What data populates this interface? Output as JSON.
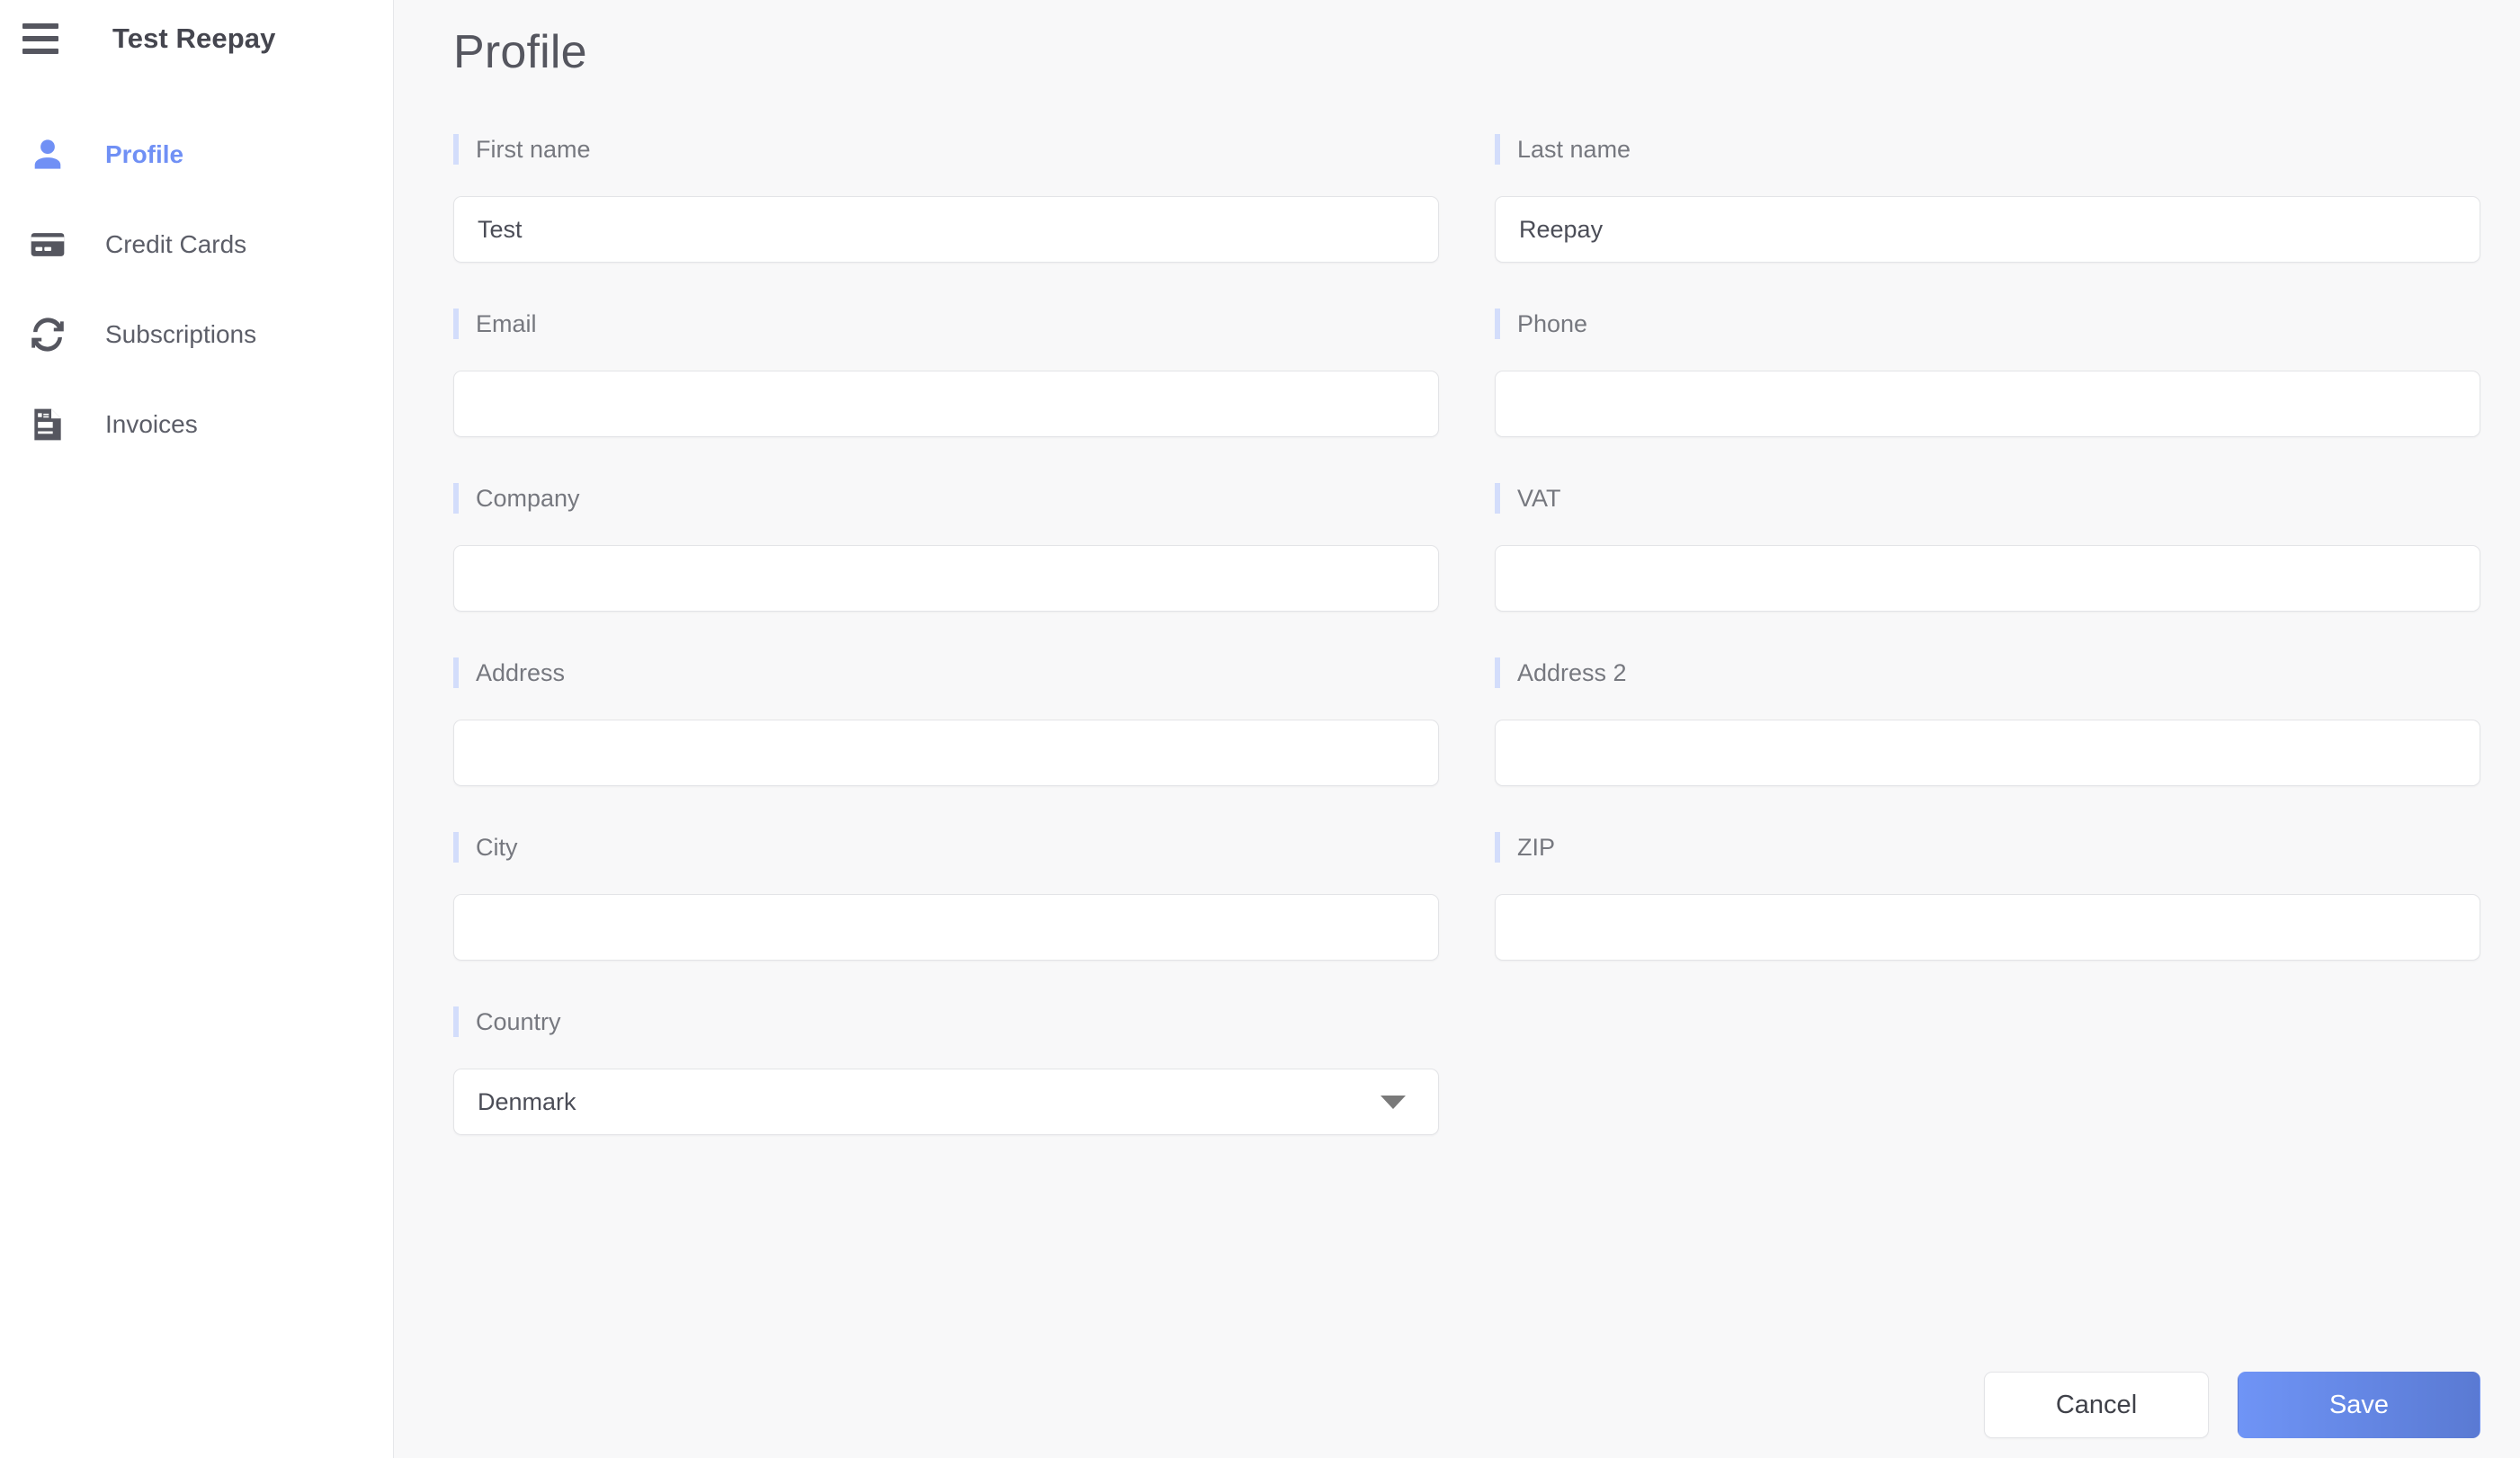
{
  "sidebar": {
    "menu_icon": "hamburger-icon",
    "brand": "Test Reepay",
    "items": [
      {
        "label": "Profile",
        "icon": "person-icon",
        "active": true
      },
      {
        "label": "Credit Cards",
        "icon": "credit-card-icon",
        "active": false
      },
      {
        "label": "Subscriptions",
        "icon": "refresh-cycle-icon",
        "active": false
      },
      {
        "label": "Invoices",
        "icon": "invoice-doc-icon",
        "active": false
      }
    ]
  },
  "main": {
    "title": "Profile",
    "fields": {
      "first_name": {
        "label": "First name",
        "value": "Test",
        "placeholder": ""
      },
      "last_name": {
        "label": "Last name",
        "value": "Reepay",
        "placeholder": ""
      },
      "email": {
        "label": "Email",
        "value": "",
        "placeholder": ""
      },
      "phone": {
        "label": "Phone",
        "value": "",
        "placeholder": ""
      },
      "company": {
        "label": "Company",
        "value": "",
        "placeholder": ""
      },
      "vat": {
        "label": "VAT",
        "value": "",
        "placeholder": ""
      },
      "address": {
        "label": "Address",
        "value": "",
        "placeholder": ""
      },
      "address2": {
        "label": "Address 2",
        "value": "",
        "placeholder": ""
      },
      "city": {
        "label": "City",
        "value": "",
        "placeholder": ""
      },
      "zip": {
        "label": "ZIP",
        "value": "",
        "placeholder": ""
      },
      "country": {
        "label": "Country",
        "value": "Denmark",
        "placeholder": "",
        "control": "select"
      }
    },
    "actions": {
      "cancel_label": "Cancel",
      "save_label": "Save"
    }
  },
  "colors": {
    "accent_blue": "#7090f5",
    "label_accent": "#d3ddfb",
    "save_gradient_from": "#6f94f6",
    "save_gradient_to": "#5a7ad3",
    "page_background": "#f8f8f9",
    "sidebar_background": "#ffffff"
  }
}
